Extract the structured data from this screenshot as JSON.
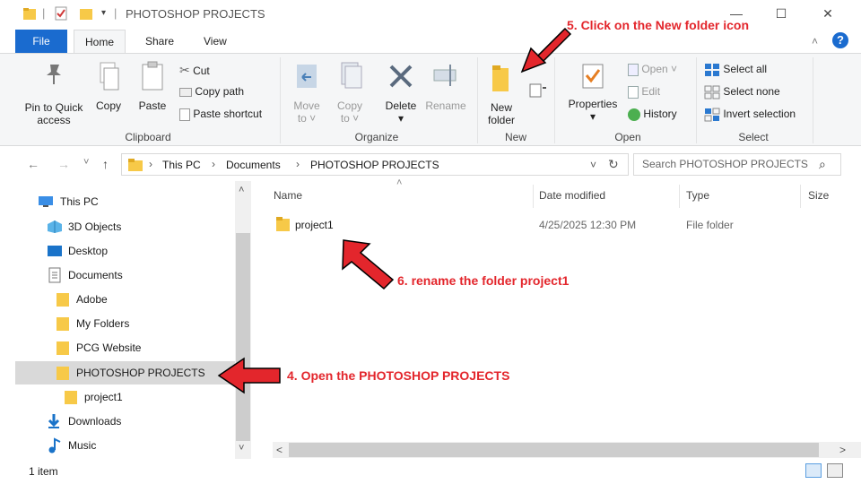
{
  "window": {
    "title": "PHOTOSHOP PROJECTS",
    "pin_glyph": "⫫",
    "minimize": "—",
    "maximize": "☐",
    "close": "✕"
  },
  "tabs": [
    {
      "label": "File"
    },
    {
      "label": "Home"
    },
    {
      "label": "Share"
    },
    {
      "label": "View"
    }
  ],
  "ribbon": {
    "clipboard": {
      "group_label": "Clipboard",
      "pin_label_1": "Pin to Quick",
      "pin_label_2": "access",
      "copy": "Copy",
      "paste": "Paste",
      "cut": "Cut",
      "copy_path": "Copy path",
      "paste_shortcut": "Paste shortcut"
    },
    "organize": {
      "group_label": "Organize",
      "move_to_1": "Move",
      "move_to_2": "to",
      "copy_to_1": "Copy",
      "copy_to_2": "to",
      "delete": "Delete",
      "rename": "Rename"
    },
    "new": {
      "group_label": "New",
      "new_folder_1": "New",
      "new_folder_2": "folder"
    },
    "open": {
      "group_label": "Open",
      "properties": "Properties",
      "open": "Open",
      "edit": "Edit",
      "history": "History"
    },
    "select": {
      "group_label": "Select",
      "select_all": "Select all",
      "select_none": "Select none",
      "invert_selection": "Invert selection"
    }
  },
  "address": {
    "this_pc": "This PC",
    "documents": "Documents",
    "current": "PHOTOSHOP PROJECTS",
    "sep": "›",
    "search_placeholder": "Search PHOTOSHOP PROJECTS"
  },
  "nav": {
    "back": "←",
    "forward": "→",
    "recent": "˅",
    "up": "↑",
    "dropdown": "˅",
    "refresh": "↻",
    "search_glyph": "⌕"
  },
  "navpane": {
    "items": [
      {
        "label": "This PC"
      },
      {
        "label": "3D Objects"
      },
      {
        "label": "Desktop"
      },
      {
        "label": "Documents"
      },
      {
        "label": "Adobe"
      },
      {
        "label": "My Folders"
      },
      {
        "label": "PCG Website"
      },
      {
        "label": "PHOTOSHOP PROJECTS"
      },
      {
        "label": "project1"
      },
      {
        "label": "Downloads"
      },
      {
        "label": "Music"
      }
    ],
    "scroll_up": "˄",
    "scroll_down": "˅"
  },
  "columns": {
    "name": "Name",
    "date_modified": "Date modified",
    "type": "Type",
    "size": "Size",
    "sort_glyph": "˄"
  },
  "files": [
    {
      "name": "project1",
      "date": "4/25/2025 12:30 PM",
      "type": "File folder"
    }
  ],
  "hscroll": {
    "left": "<",
    "right": ">"
  },
  "status": {
    "count": "1 item"
  },
  "annotations": {
    "step4": "4. Open the PHOTOSHOP PROJECTS",
    "step5": "5.  Click on the New folder icon",
    "step6": "6.  rename the folder project1"
  },
  "colors": {
    "accent": "#1a6bcf",
    "folder": "#f7c948",
    "annotation": "#e3262c",
    "selected": "#d9d9d9"
  }
}
